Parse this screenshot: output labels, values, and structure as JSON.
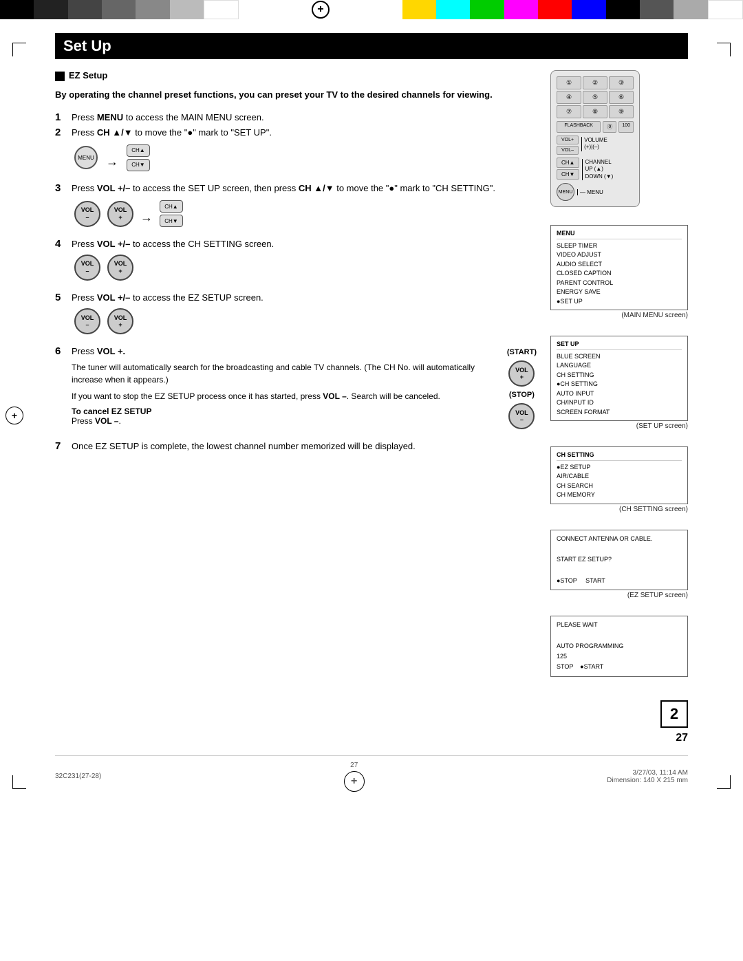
{
  "top_bar": {
    "black_blocks": [
      "#000",
      "#333",
      "#555",
      "#777",
      "#999",
      "#bbb",
      "#fff"
    ],
    "color_blocks": [
      "#FFD700",
      "#00FFFF",
      "#00CC00",
      "#FF00FF",
      "#FF0000",
      "#0000FF",
      "#000",
      "#555",
      "#bbb",
      "#fff"
    ]
  },
  "page": {
    "title": "Set Up",
    "section": {
      "marker": "■",
      "name": "EZ Setup",
      "intro_bold": "By operating the channel preset functions, you can preset your TV to the desired channels for viewing."
    },
    "steps": [
      {
        "num": "1",
        "text": "Press ",
        "bold": "MENU",
        "rest": " to access the MAIN MENU screen."
      },
      {
        "num": "2",
        "text": "Press ",
        "bold": "CH ▲/▼",
        "rest": " to move the \"●\" mark to \"SET UP\"."
      },
      {
        "num": "3",
        "text": "Press ",
        "bold": "VOL +/–",
        "rest": " to access the SET UP screen, then press ",
        "bold2": "CH ▲/▼",
        "rest2": " to move the \"●\" mark to \"CH SETTING\"."
      },
      {
        "num": "4",
        "text": "Press ",
        "bold": "VOL +/–",
        "rest": " to access the CH SETTING screen."
      },
      {
        "num": "5",
        "text": "Press ",
        "bold": "VOL +/–",
        "rest": " to access the EZ SETUP screen."
      },
      {
        "num": "6",
        "text": "Press ",
        "bold": "VOL +.",
        "rest_lines": [
          "The tuner will automatically search for the broadcasting and cable TV channels. (The CH No. will automatically increase when it appears.)",
          "If you want to stop the EZ SETUP process once it has started, press VOL –. Search will be canceled."
        ],
        "start_label": "(START)",
        "stop_label": "(STOP)",
        "cancel_note_bold": "To cancel EZ SETUP",
        "cancel_note": "Press VOL –."
      },
      {
        "num": "7",
        "text": "Once EZ SETUP is complete, the lowest channel number memorized will be displayed."
      }
    ],
    "screens": {
      "main_menu": {
        "title": "MENU",
        "items": [
          "SLEEP TIMER",
          "VIDEO ADJUST",
          "AUDIO SELECT",
          "CLOSED CAPTION",
          "PARENT CONTROL",
          "ENERGY SAVE",
          "●SET UP"
        ],
        "caption": "(MAIN MENU screen)"
      },
      "set_up": {
        "title": "SET UP",
        "items": [
          "BLUE SCREEN",
          "LANGUAGE",
          "CH SETTING",
          "●CH SETTING",
          "AUTO INPUT",
          "CH/INPUT ID",
          "SCREEN FORMAT"
        ],
        "caption": "(SET UP screen)"
      },
      "ch_setting": {
        "title": "CH SETTING",
        "items": [
          "●EZ SETUP",
          "AIR/CABLE",
          "CH SEARCH",
          "CH MEMORY"
        ],
        "caption": "(CH SETTING screen)"
      },
      "ez_setup": {
        "lines": [
          "CONNECT ANTENNA OR CABLE.",
          "",
          "START EZ SETUP?",
          "",
          "●STOP    START"
        ],
        "caption": "(EZ SETUP screen)"
      },
      "programming": {
        "lines": [
          "PLEASE WAIT",
          "",
          "AUTO PROGRAMMING",
          "125",
          "STOP  ●START"
        ],
        "caption": ""
      }
    },
    "remote": {
      "volume_label": "VOLUME\n(+)|(–)",
      "channel_label": "CHANNEL\nUP (▲)\nDOWN (▼)",
      "menu_label": "MENU",
      "nums": [
        "①②③",
        "④⑤⑥",
        "⑦⑧⑨"
      ],
      "cha": "CH▲",
      "chv": "CH▼",
      "vol_plus": "VOL\n+",
      "vol_minus": "VOL\n–"
    },
    "footer": {
      "left": "32C231(27-28)",
      "center": "27",
      "right_date": "3/27/03, 11:14 AM",
      "dimension": "Dimension: 140 X 215 mm"
    },
    "page_number": "27",
    "page_number_box": "2"
  }
}
